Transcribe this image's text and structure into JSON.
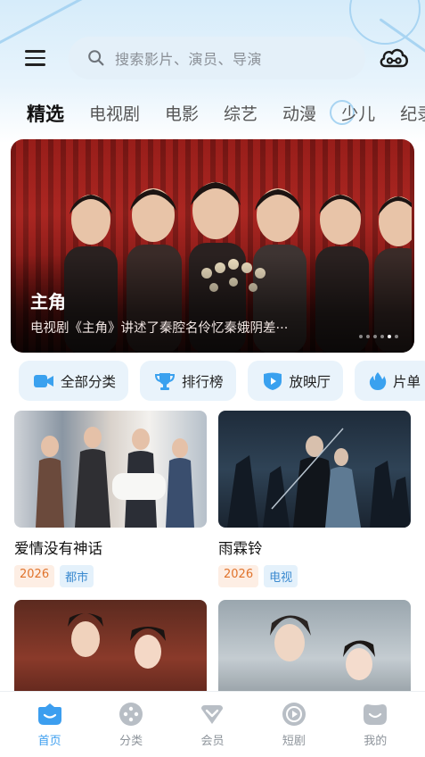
{
  "header": {
    "search_placeholder": "搜索影片、演员、导演"
  },
  "tabs": [
    {
      "label": "精选",
      "active": true
    },
    {
      "label": "电视剧"
    },
    {
      "label": "电影"
    },
    {
      "label": "综艺"
    },
    {
      "label": "动漫"
    },
    {
      "label": "少儿"
    },
    {
      "label": "纪录"
    }
  ],
  "banner": {
    "title": "主角",
    "description": "电视剧《主角》讲述了秦腔名伶忆秦娥阴差···",
    "page_count": 6,
    "active_page": 4
  },
  "chips": [
    {
      "label": "全部分类",
      "icon": "video-camera-icon"
    },
    {
      "label": "排行榜",
      "icon": "trophy-icon"
    },
    {
      "label": "放映厅",
      "icon": "play-shield-icon"
    },
    {
      "label": "片单",
      "icon": "flame-icon"
    }
  ],
  "cards": [
    {
      "title": "爱情没有神话",
      "year": "2026",
      "genre": "都市"
    },
    {
      "title": "雨霖铃",
      "year": "2026",
      "genre": "电视"
    },
    {
      "title": "",
      "year": "",
      "genre": ""
    },
    {
      "title": "",
      "year": "",
      "genre": ""
    }
  ],
  "nav": [
    {
      "label": "首页",
      "active": true,
      "icon": "home-icon"
    },
    {
      "label": "分类",
      "icon": "category-icon"
    },
    {
      "label": "会员",
      "icon": "vip-icon"
    },
    {
      "label": "短剧",
      "icon": "play-circle-icon"
    },
    {
      "label": "我的",
      "icon": "profile-icon"
    }
  ],
  "colors": {
    "accent": "#3c9eef",
    "year_tag": "#e0732c",
    "genre_tag": "#3d8bd0"
  }
}
